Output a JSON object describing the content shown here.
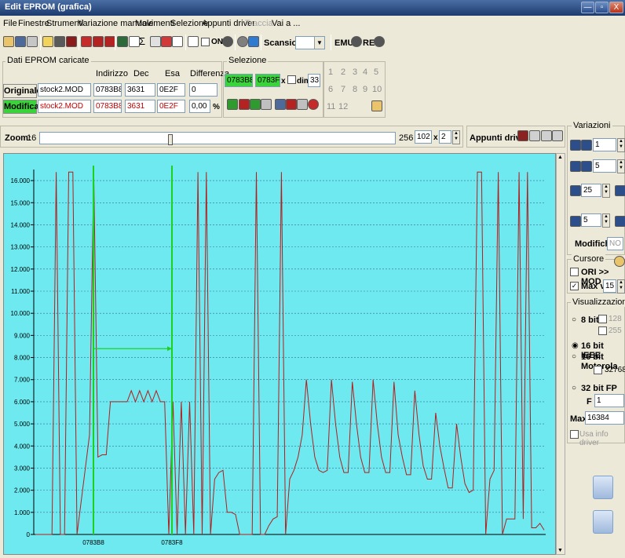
{
  "window": {
    "title": "Edit EPROM (grafica)",
    "minimize_label": "—",
    "restore_label": "▫",
    "close_label": "X"
  },
  "menu": [
    "File",
    "Finestre",
    "Strumenti",
    "Variazione manuale",
    "Movimenti",
    "Selezione",
    "Appunti driver",
    "Traccia",
    "Vai a ..."
  ],
  "toolbar": {
    "on_label": "ON",
    "scansione_label": "Scansione",
    "emu_label": "EMU",
    "reg_label": "REG"
  },
  "dati": {
    "title": "Dati EPROM caricate",
    "headers": {
      "indirizzo": "Indirizzo",
      "dec": "Dec",
      "esa": "Esa",
      "differenza": "Differenza"
    },
    "originale": {
      "label": "Originale",
      "file": "stock2.MOD",
      "indirizzo": "0783B8",
      "dec": "3631",
      "esa": "0E2F",
      "differenza": "0"
    },
    "modificato": {
      "label": "Modificato",
      "file": "stock2.MOD",
      "indirizzo": "0783B8",
      "dec": "3631",
      "esa": "0E2F",
      "differenza": "0,00",
      "unit": "%"
    }
  },
  "selezione": {
    "title": "Selezione",
    "start": "0783B8",
    "end": "0783F8",
    "x_label": "x",
    "dim_label": "dim.",
    "dim_value": "33"
  },
  "numpad": [
    "1",
    "2",
    "3",
    "4",
    "5",
    "6",
    "7",
    "8",
    "9",
    "10",
    "11",
    "12"
  ],
  "zoom": {
    "label": "Zoom:",
    "min": "16",
    "max": "256",
    "value": "102",
    "x_label": "x",
    "mult": "2",
    "level_fraction": 0.37
  },
  "appunti_label": "Appunti driver:",
  "variazioni": {
    "title": "Variazioni",
    "v1": "1",
    "v2": "5",
    "v3": "25",
    "v4": "5",
    "modifiche_label": "Modifiche:",
    "modifiche_value": "NO"
  },
  "cursore": {
    "title": "Cursore",
    "ori_mod": "ORI >> MOD",
    "max_var_label": "Max var",
    "max_var_value": "15",
    "ori_checked": false,
    "max_checked": true
  },
  "visualizzazione": {
    "title": "Visualizzazione",
    "bit8": "8 bit",
    "v128": "128",
    "v255": "255",
    "bit16ieee": "16 bit IEEE",
    "bit16mot": "16 bit Motorola",
    "v32768": "32768",
    "bit32fp": "32 bit FP",
    "f_label": "F",
    "f_value": "1",
    "max_label": "Max",
    "max_value": "16384",
    "usa_info": "Usa info driver",
    "selected": "16 bit IEEE"
  },
  "chart_data": {
    "type": "line",
    "y_ticks": [
      "0",
      "1.000",
      "2.000",
      "3.000",
      "4.000",
      "5.000",
      "6.000",
      "7.000",
      "8.000",
      "9.000",
      "10.000",
      "11.000",
      "12.000",
      "13.000",
      "14.000",
      "15.000",
      "16.000"
    ],
    "ylim": [
      0,
      16500
    ],
    "x_labels": [
      "0783B8",
      "0783F8"
    ],
    "selection_start_label": "0783B8",
    "selection_end_label": "0783F8",
    "series": [
      {
        "values": [
          0,
          0,
          0,
          0,
          0,
          16384,
          0,
          0,
          16384,
          16384,
          0,
          1500,
          3000,
          4500,
          16384,
          3500,
          3600,
          3600,
          6000,
          6000,
          6000,
          6000,
          6000,
          6500,
          6000,
          6500,
          6000,
          6500,
          6000,
          6500,
          6000,
          6000,
          0,
          6000,
          0,
          6000,
          0,
          6000,
          0,
          16384,
          0,
          16384,
          0,
          2500,
          2800,
          2900,
          1000,
          1000,
          900,
          0,
          0,
          0,
          0,
          16384,
          0,
          0,
          400,
          700,
          800,
          16384,
          0,
          2500,
          2900,
          3500,
          4500,
          7000,
          5000,
          3500,
          2900,
          2800,
          2900,
          7000,
          5000,
          3500,
          2800,
          2800,
          6900,
          5000,
          3500,
          2800,
          2800,
          7000,
          5000,
          3500,
          2800,
          2800,
          6900,
          4500,
          3500,
          2700,
          2700,
          6500,
          4500,
          3100,
          2500,
          2500,
          5500,
          4000,
          3000,
          2100,
          2100,
          5000,
          3500,
          2300,
          1900,
          2000,
          16384,
          16384,
          0,
          2500,
          2900,
          16384,
          0,
          700,
          700,
          700,
          16384,
          700,
          16384,
          300,
          300,
          500,
          200
        ]
      }
    ]
  }
}
